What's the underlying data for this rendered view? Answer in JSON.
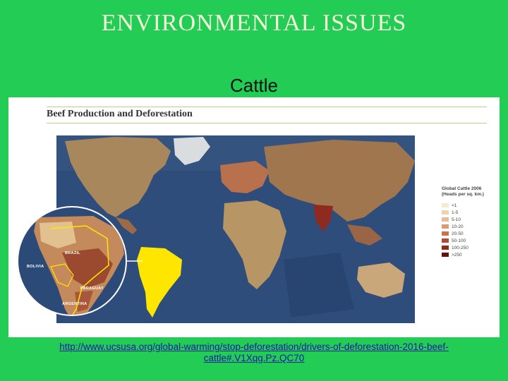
{
  "slide": {
    "title": "ENVIRONMENTAL ISSUES",
    "subtitle": "Cattle"
  },
  "figure": {
    "title": "Beef Production and Deforestation",
    "legend": {
      "title_line1": "Global Cattle 2006",
      "title_line2": "(Heads per sq. km.)",
      "items": [
        {
          "label": "<1",
          "color": "#f3ead2"
        },
        {
          "label": "1-5",
          "color": "#ecd3b4"
        },
        {
          "label": "5-10",
          "color": "#e5bb98"
        },
        {
          "label": "10-20",
          "color": "#d99a74"
        },
        {
          "label": "20-50",
          "color": "#c9714f"
        },
        {
          "label": "50-100",
          "color": "#b24a35"
        },
        {
          "label": "100-250",
          "color": "#8e2a1f"
        },
        {
          "label": ">250",
          "color": "#5c1410"
        }
      ]
    },
    "inset_labels": {
      "brazil": "BRAZIL",
      "bolivia": "BOLIVIA",
      "paraguay": "PARAGUAY",
      "argentina": "ARGENTINA"
    },
    "colors": {
      "ocean": "#2f4d7a",
      "highlight": "#ffe600",
      "inset_ring": "#ffffff"
    }
  },
  "source": {
    "url": "http://www.ucsusa.org/global-warming/stop-deforestation/drivers-of-deforestation-2016-beef-cattle#.V1Xqg.Pz.QC70"
  }
}
